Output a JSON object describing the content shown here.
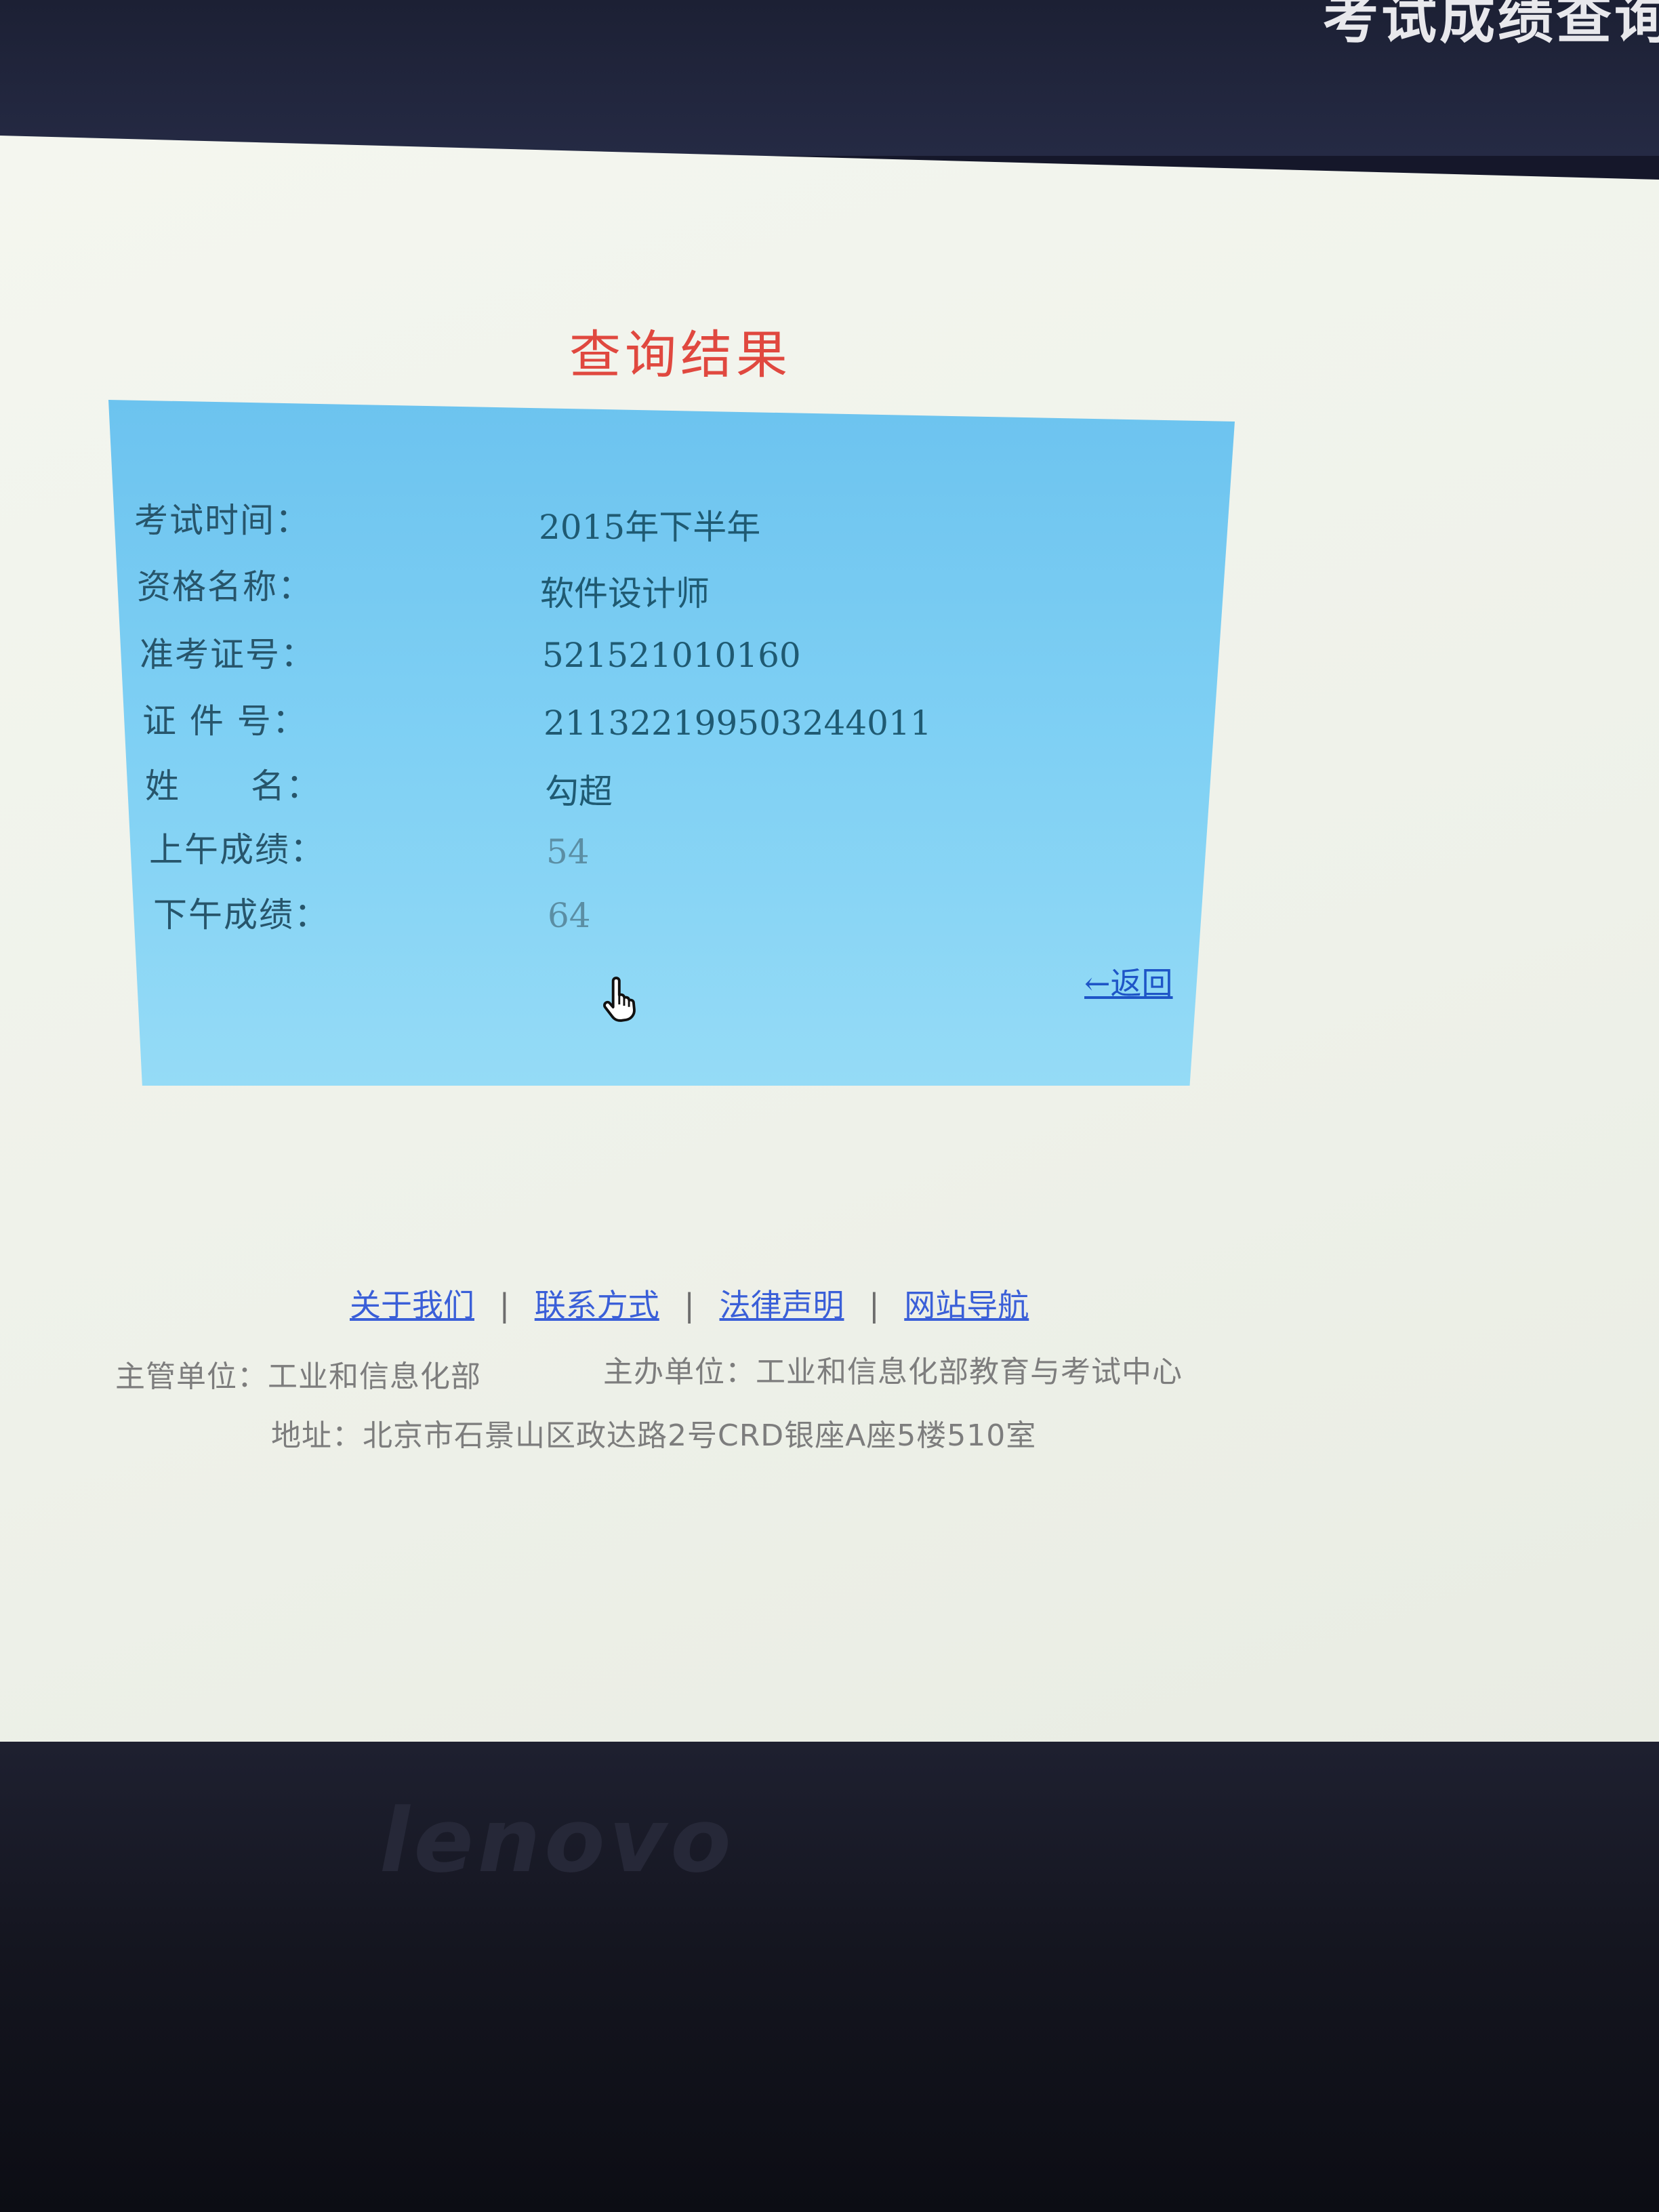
{
  "header": {
    "title": "考试成绩查询"
  },
  "result": {
    "title": "查询结果",
    "rows": [
      {
        "label": "考试时间：",
        "value": "2015年下半年"
      },
      {
        "label": "资格名称：",
        "value": "软件设计师"
      },
      {
        "label": "准考证号：",
        "value": "521521010160"
      },
      {
        "label": "证 件 号：",
        "value": "211322199503244011"
      },
      {
        "label": "姓　　名：",
        "value": "勾超"
      },
      {
        "label": "上午成绩：",
        "value": "54"
      },
      {
        "label": "下午成绩：",
        "value": "64"
      }
    ],
    "back_label": "←返回"
  },
  "footer": {
    "links": [
      "关于我们",
      "联系方式",
      "法律声明",
      "网站导航"
    ],
    "separator": "|",
    "supervisor": "主管单位：工业和信息化部",
    "organizer": "主办单位：工业和信息化部教育与考试中心",
    "address": "地址：北京市石景山区政达路2号CRD银座A座5楼510室"
  },
  "device": {
    "brand": "lenovo"
  },
  "icons": {
    "cursor": "hand-pointer-icon"
  }
}
